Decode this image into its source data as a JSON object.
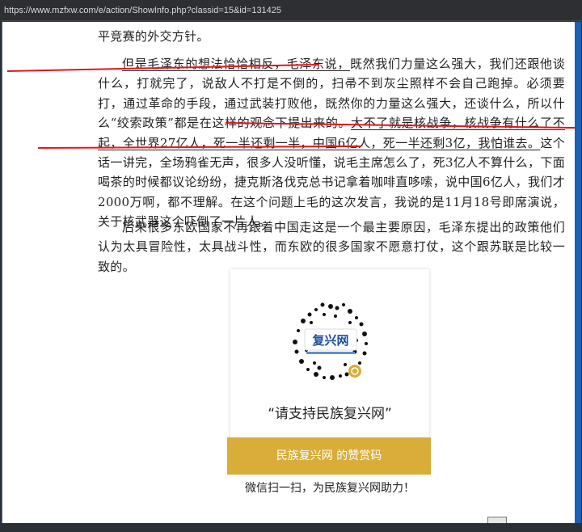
{
  "browser": {
    "url": "https://www.mzfxw.com/e/action/ShowInfo.php?classid=15&id=131425"
  },
  "article": {
    "p0": "平竞赛的外交方针。",
    "p1": {
      "seg_a": "但是毛泽东的想法恰恰相反，毛泽东说，",
      "seg_b": "既然我们力量这么强大，我们还跟他谈什么，打就完了，说敌人不打是不倒的，扫帚不到灰尘照样不会自己跑掉。必须要打，通过革命的手段，通过武装打败他，既然你的力量这么强大，还谈什么，所以什么“绞索政策”都是在这样的观念下提出来的。",
      "seg_c": "大不了就是核战争，核战争有什么了不起，全世界27亿人，死一半还剩一半，中国6亿人，死一半还剩3亿，我怕谁去。",
      "seg_d": "这个话一讲完，全场鸦雀无声，很多人没听懂，说毛主席怎么了，死3亿人不算什么，下面喝茶的时候都议论纷纷，捷克斯洛伐克总书记拿着咖啡直哆嗦，说中国6亿人，我们才2000万啊，都不理解。在这个问题上毛的这次发言，我说的是11月18号即席演说，关于核武器这个吓倒了一片人。"
    },
    "p2": "后来很多东欧国家不再跟着中国走这是一个最主要原因，毛泽东提出的政策他们认为太具冒险性，太具战斗性，而东欧的很多国家不愿意打仗，这个跟苏联是比较一致的。"
  },
  "qr": {
    "logo_text": "复兴网",
    "slogan": "“请支持民族复兴网”",
    "band": "民族复兴网 的赞赏码",
    "caption": "微信扫一扫，为民族复兴网助力！"
  },
  "colors": {
    "annotation": "#e3161c",
    "band": "#d8ad3a",
    "scrollbar": "#1a5fb4"
  }
}
